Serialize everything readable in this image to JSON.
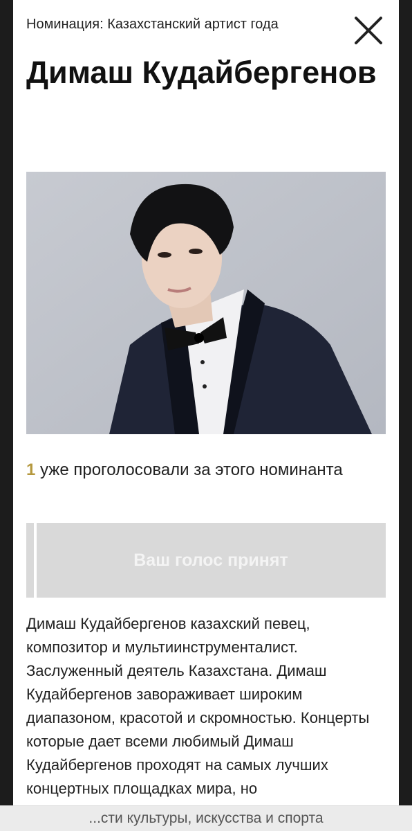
{
  "modal": {
    "nomination_label": "Номинация: Казахстанский артист года",
    "close_icon": "close-x-icon",
    "nominee_name": "Димаш Кудайбергенов"
  },
  "votes": {
    "count": "1",
    "text": " уже проголосовали за этого номинанта"
  },
  "vote_button": {
    "label": "Ваш голос принят",
    "state": "disabled"
  },
  "description": "Димаш Кудайбергенов казахский певец, композитор и мультиинструменталист. Заслуженный деятель Казахстана. Димаш Кудайбергенов завораживает широким диапазоном, красотой и скромностью. Концерты которые дает всеми любимый Димаш Кудайбергенов проходят на самых лучших концертных площадках мира, но",
  "bottom_bar": {
    "text": "...сти культуры, искусства и спорта"
  },
  "colors": {
    "accent_gold": "#b5983e",
    "button_bg": "#d9d9d9",
    "overlay": "#1c1c1c"
  }
}
